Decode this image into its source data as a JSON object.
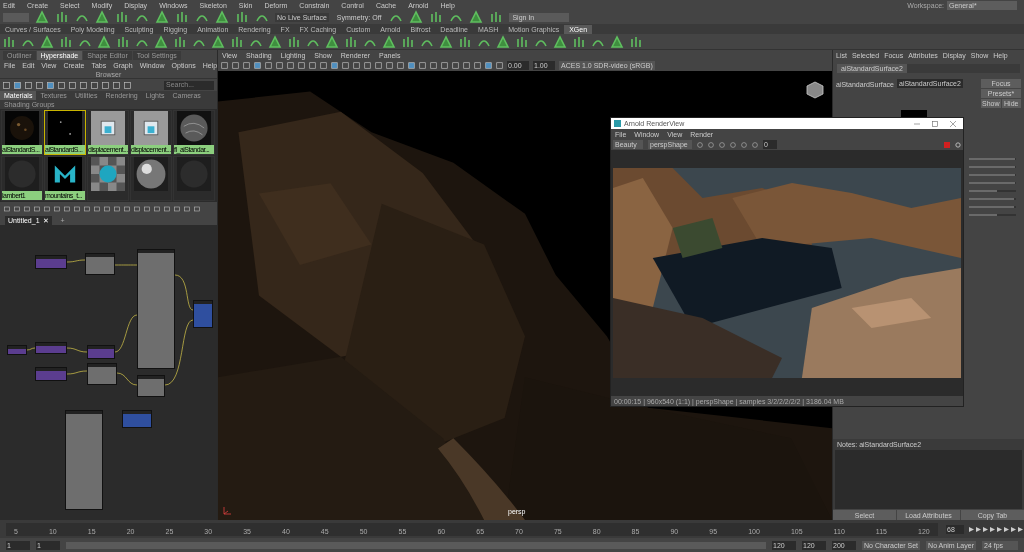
{
  "main_menu": [
    "Edit",
    "Create",
    "Select",
    "Modify",
    "Display",
    "Windows",
    "Skeleton",
    "Skin",
    "Deform",
    "Constrain",
    "Control",
    "Cache",
    "Arnold",
    "Help"
  ],
  "workspace": {
    "label": "Workspace:",
    "value": "General*"
  },
  "status_line": {
    "live_surface": "No Live Surface",
    "symmetry": "Symmetry: Off",
    "sign_in": "Sign In"
  },
  "shelf_tabs": [
    {
      "label": "Curves / Surfaces",
      "selected": false
    },
    {
      "label": "Poly Modeling",
      "selected": false
    },
    {
      "label": "Sculpting",
      "selected": false
    },
    {
      "label": "Rigging",
      "selected": false
    },
    {
      "label": "Animation",
      "selected": false
    },
    {
      "label": "Rendering",
      "selected": false
    },
    {
      "label": "FX",
      "selected": false
    },
    {
      "label": "FX Caching",
      "selected": false
    },
    {
      "label": "Custom",
      "selected": false
    },
    {
      "label": "Arnold",
      "selected": false
    },
    {
      "label": "Bifrost",
      "selected": false
    },
    {
      "label": "Deadline",
      "selected": false
    },
    {
      "label": "MASH",
      "selected": false
    },
    {
      "label": "Motion Graphics",
      "selected": false
    },
    {
      "label": "XGen",
      "selected": true
    }
  ],
  "left_panel": {
    "tabs": [
      {
        "label": "Outliner",
        "selected": false
      },
      {
        "label": "Hypershade",
        "selected": true
      },
      {
        "label": "Shape Editor",
        "selected": false
      },
      {
        "label": "Tool Settings",
        "selected": false
      }
    ],
    "menu": [
      "File",
      "Edit",
      "View",
      "Create",
      "Tabs",
      "Graph",
      "Window",
      "Options",
      "Help"
    ],
    "browser_title": "Browser",
    "search": {
      "placeholder": "Search..."
    },
    "browser_tabs": [
      {
        "label": "Materials",
        "selected": true
      },
      {
        "label": "Textures",
        "selected": false
      },
      {
        "label": "Utilities",
        "selected": false
      },
      {
        "label": "Rendering",
        "selected": false
      },
      {
        "label": "Lights",
        "selected": false
      },
      {
        "label": "Cameras",
        "selected": false
      },
      {
        "label": "Shading Groups",
        "selected": false
      }
    ],
    "swatches": [
      {
        "kind": "speckle",
        "label": "aiStandardS...",
        "selected": false
      },
      {
        "kind": "dots",
        "label": "aiStandardS...",
        "selected": true
      },
      {
        "kind": "cubes",
        "label": "displacement...",
        "selected": false
      },
      {
        "kind": "cubes",
        "label": "displacement...",
        "selected": false
      },
      {
        "kind": "rock",
        "label": "fl_aiStandar...",
        "selected": false
      },
      {
        "kind": "dark",
        "label": "lambert1",
        "selected": false
      },
      {
        "kind": "logo",
        "label": "mountains_t...",
        "selected": false
      },
      {
        "kind": "checker",
        "selected": false
      },
      {
        "kind": "chrome",
        "selected": false
      },
      {
        "kind": "dark",
        "selected": false
      }
    ],
    "graph_tabs": [
      {
        "label": "Untitled_1",
        "close": "✕",
        "selected": true
      },
      {
        "label": "+",
        "selected": false
      }
    ]
  },
  "viewport": {
    "menu": [
      "View",
      "Shading",
      "Lighting",
      "Show",
      "Renderer",
      "Panels"
    ],
    "exposure": "0.00",
    "gamma": "1.00",
    "color_space": "ACES 1.0 SDR-video (sRGB)",
    "camera_label": "persp"
  },
  "render_view": {
    "title": "Arnold RenderView",
    "menu": [
      "File",
      "Window",
      "View",
      "Render"
    ],
    "aov": "Beauty",
    "camera": "perspShape",
    "value": "0",
    "status": "00:00:15 | 960x540 (1:1) | perspShape | samples 3/2/2/2/2/2 | 3186.04 MB"
  },
  "attribute_editor": {
    "menu": [
      "List",
      "Selected",
      "Focus",
      "Attributes",
      "Display",
      "Show",
      "Help"
    ],
    "tab": "aiStandardSurface2",
    "node_label": "aiStandardSurface",
    "node_name": "aiStandardSurface2",
    "buttons": [
      "Focus",
      "Presets*",
      "Show",
      "Hide"
    ],
    "sliders": [
      {
        "level": 0.97
      },
      {
        "level": 0.97
      },
      {
        "level": 0.97
      },
      {
        "level": 0.97
      },
      {
        "level": 0.6
      },
      {
        "level": 0.95
      },
      {
        "level": 0.95
      },
      {
        "level": 0.6
      }
    ],
    "notes": "Notes:  aiStandardSurface2",
    "bottom_buttons": [
      "Select",
      "Load Attributes",
      "Copy Tab"
    ]
  },
  "timeline": {
    "ticks": [
      "5",
      "10",
      "15",
      "20",
      "25",
      "30",
      "35",
      "40",
      "45",
      "50",
      "55",
      "60",
      "65",
      "70",
      "75",
      "80",
      "85",
      "90",
      "95",
      "100",
      "105",
      "110",
      "115",
      "120"
    ],
    "current": "68"
  },
  "range": {
    "level": 1,
    "start": "1",
    "inner_start": "1",
    "inner_end": "120",
    "end": "120",
    "max": "200",
    "character_set": "No Character Set",
    "anim_layer": "No Anim Layer",
    "fps": "24 fps"
  }
}
